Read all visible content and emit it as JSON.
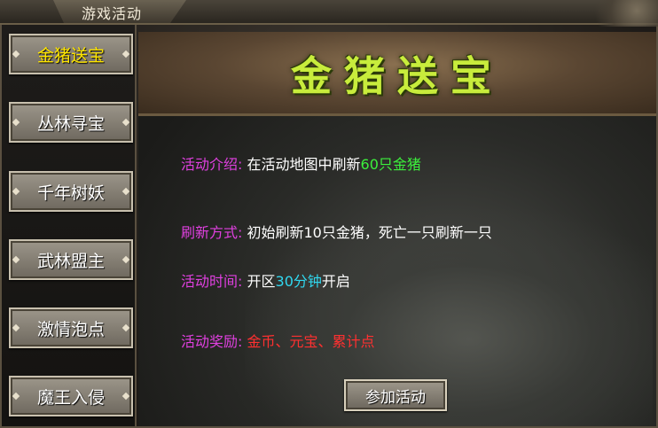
{
  "window": {
    "title": "游戏活动"
  },
  "sidebar": {
    "items": [
      {
        "label": "金猪送宝",
        "active": true
      },
      {
        "label": "丛林寻宝"
      },
      {
        "label": "千年树妖"
      },
      {
        "label": "武林盟主"
      },
      {
        "label": "激情泡点"
      },
      {
        "label": "魔王入侵"
      }
    ]
  },
  "banner": {
    "title": "金猪送宝"
  },
  "details": {
    "intro_label": "活动介绍:",
    "intro_text_1": "在活动地图中刷新",
    "intro_highlight": "60只金猪",
    "refresh_label": "刷新方式:",
    "refresh_text": "初始刷新10只金猪，死亡一只刷新一只",
    "time_label": "活动时间:",
    "time_text_1": "开区",
    "time_highlight": "30分钟",
    "time_text_2": "开启",
    "reward_label": "活动奖励:",
    "reward_text": "金币、元宝、累计点"
  },
  "join_button": "参加活动",
  "colors": {
    "label": "#e040e0",
    "highlight_green": "#3cf03c",
    "highlight_cyan": "#30d8f0",
    "reward_red": "#ff3030",
    "active_tab": "#ffe600",
    "banner_title": "#c8ec3c"
  }
}
